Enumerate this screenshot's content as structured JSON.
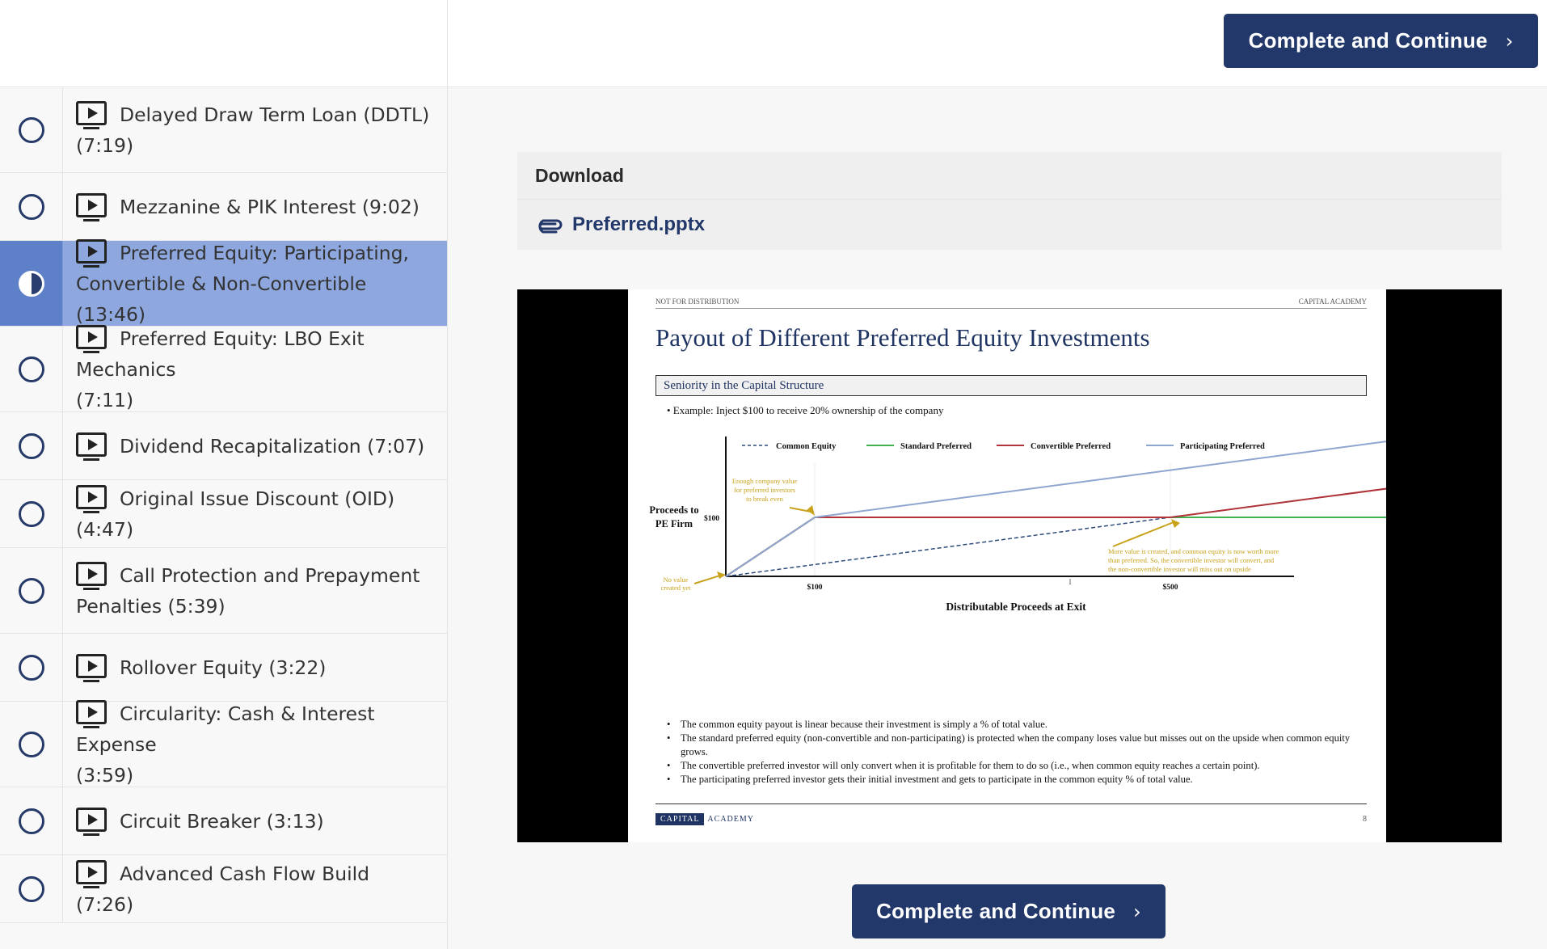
{
  "sidebar": {
    "lessons": [
      {
        "title": "Delayed Draw Term Loan (DDTL) (7:19)",
        "line1": "Delayed Draw Term Loan (DDTL)",
        "line2": "(7:19)",
        "status": "incomplete"
      },
      {
        "title": "Mezzanine & PIK Interest (9:02)",
        "line1": "Mezzanine & PIK Interest (9:02)",
        "line2": "",
        "status": "incomplete"
      },
      {
        "title": "Preferred Equity: Participating, Convertible & Non-Convertible (13:46)",
        "line1": "Preferred Equity: Participating,",
        "line2": "Convertible & Non-Convertible (13:46)",
        "status": "in-progress"
      },
      {
        "title": "Preferred Equity: LBO Exit Mechanics (7:11)",
        "line1": "Preferred Equity: LBO Exit Mechanics",
        "line2": "(7:11)",
        "status": "incomplete"
      },
      {
        "title": "Dividend Recapitalization (7:07)",
        "line1": "Dividend Recapitalization (7:07)",
        "line2": "",
        "status": "incomplete"
      },
      {
        "title": "Original Issue Discount (OID) (4:47)",
        "line1": "Original Issue Discount (OID) (4:47)",
        "line2": "",
        "status": "incomplete"
      },
      {
        "title": "Call Protection and Prepayment Penalties (5:39)",
        "line1": "Call Protection and Prepayment",
        "line2": "Penalties (5:39)",
        "status": "incomplete"
      },
      {
        "title": "Rollover Equity (3:22)",
        "line1": "Rollover Equity (3:22)",
        "line2": "",
        "status": "incomplete"
      },
      {
        "title": "Circularity: Cash & Interest Expense (3:59)",
        "line1": "Circularity: Cash & Interest Expense",
        "line2": "(3:59)",
        "status": "incomplete"
      },
      {
        "title": "Circuit Breaker (3:13)",
        "line1": "Circuit Breaker (3:13)",
        "line2": "",
        "status": "incomplete"
      },
      {
        "title": "Advanced Cash Flow Build (7:26)",
        "line1": "Advanced Cash Flow Build (7:26)",
        "line2": "",
        "status": "incomplete"
      }
    ]
  },
  "topbar": {
    "complete_label": "Complete and Continue"
  },
  "download": {
    "title": "Download",
    "file_name": "Preferred.pptx"
  },
  "slide": {
    "header_left": "NOT FOR DISTRIBUTION",
    "header_right": "CAPITAL ACADEMY",
    "title": "Payout of Different Preferred Equity Investments",
    "section": "Seniority in the Capital Structure",
    "example": "•   Example: Inject $100 to receive 20% ownership of the company",
    "bullets": [
      "The common equity payout is linear because their investment is simply a % of total value.",
      "The standard preferred equity (non-convertible and non-participating) is protected when the company loses value but misses out on the upside when common equity grows.",
      "The convertible preferred investor will only convert when it is profitable for them to do so (i.e., when common equity reaches a certain point).",
      "The participating preferred investor gets their initial investment and gets to participate in the common equity % of total value."
    ],
    "footer_logo_1": "CAPITAL",
    "footer_logo_2": "ACADEMY",
    "page_number": "8"
  },
  "chart_data": {
    "type": "line",
    "xlabel": "Distributable Proceeds at Exit",
    "ylabel": "Proceeds to PE Firm",
    "x_ticks": [
      "$100",
      "$500"
    ],
    "y_ticks": [
      "$100"
    ],
    "legend_position": "top",
    "series": [
      {
        "name": "Common Equity",
        "color": "#2e4a7a",
        "style": "dashed",
        "x": [
          0,
          100,
          500,
          810
        ],
        "y": [
          0,
          20,
          100,
          162
        ]
      },
      {
        "name": "Standard Preferred",
        "color": "#3fb24f",
        "style": "solid",
        "x": [
          0,
          100,
          500,
          810
        ],
        "y": [
          0,
          100,
          100,
          100
        ]
      },
      {
        "name": "Convertible Preferred",
        "color": "#b0343a",
        "style": "solid",
        "x": [
          0,
          100,
          500,
          810
        ],
        "y": [
          0,
          100,
          100,
          162
        ]
      },
      {
        "name": "Participating Preferred",
        "color": "#8fa6cf",
        "style": "solid",
        "x": [
          0,
          100,
          500,
          810
        ],
        "y": [
          0,
          100,
          180,
          242
        ]
      }
    ],
    "annotations": [
      "Enough company value for preferred investors to break even",
      "More value is created, and common equity is now worth more than preferred. So, the convertible investor will convert, and the non-convertible investor will miss out on upside",
      "No value created yet"
    ],
    "annotation_color": "#c9a21c"
  }
}
